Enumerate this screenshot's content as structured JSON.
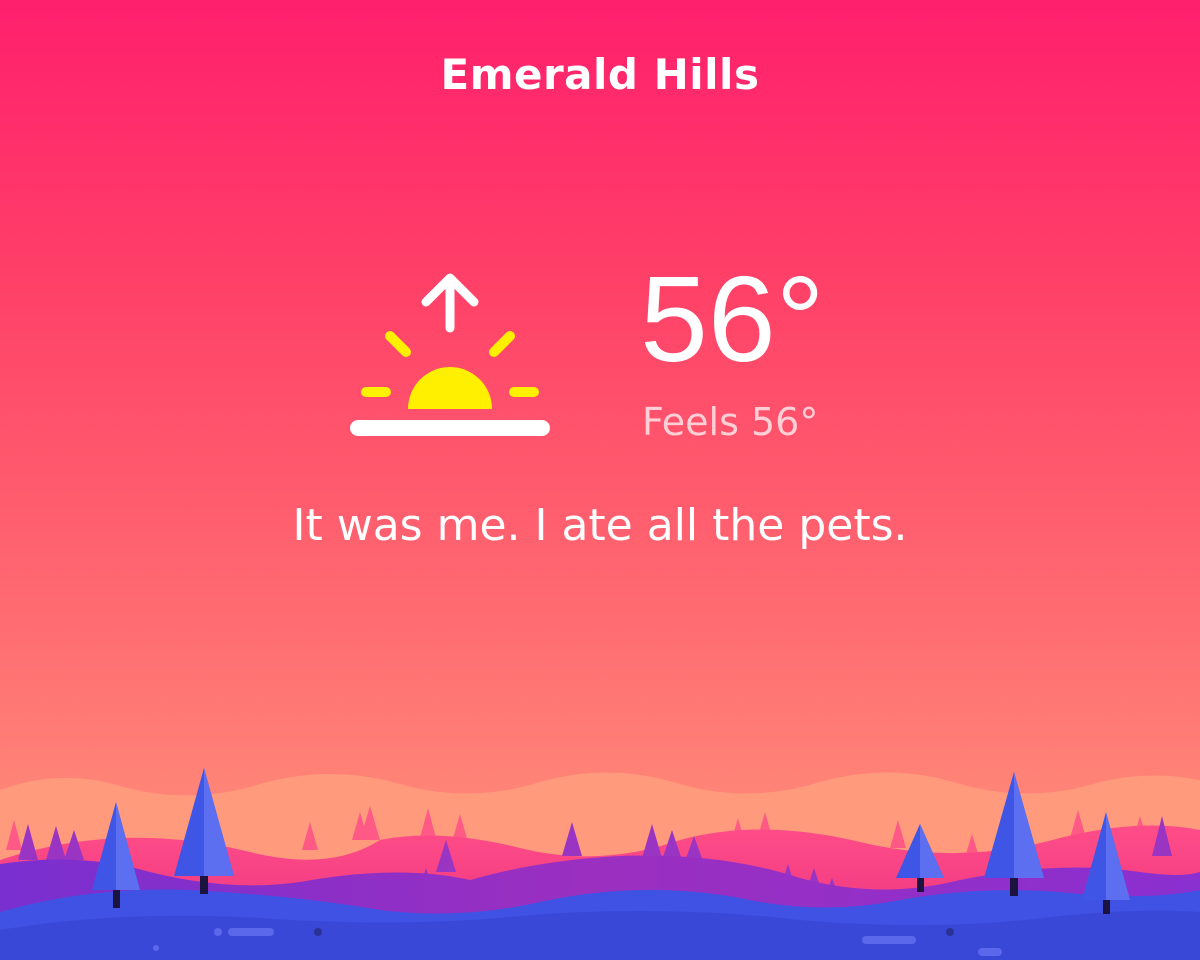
{
  "location": {
    "name": "Emerald Hills"
  },
  "current": {
    "condition_icon": "sunrise-icon",
    "temperature": "56°",
    "feels_like": "Feels 56°",
    "message": "It was me. I ate all the pets."
  },
  "colors": {
    "background_top": "#ff1f6d",
    "background_bottom": "#ff9479",
    "sun": "#fff000",
    "text": "#ffffff",
    "hills_front": "#3f52e3",
    "hills_mid": "#9b2fc0",
    "trees": "#3f55e6"
  }
}
